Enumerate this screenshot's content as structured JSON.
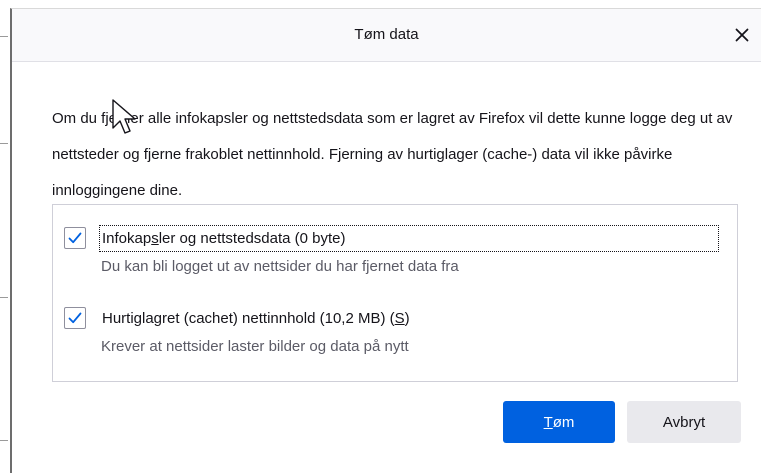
{
  "dialog": {
    "title": "Tøm data",
    "close_glyph": "✕",
    "description": "Om du fjerner alle infokapsler og nettstedsdata som er lagret av Firefox vil dette kunne logge deg ut av nettsteder og fjerne frakoblet nettinnhold. Fjerning av hurtiglager (cache-) data vil ikke påvirke innloggingene dine.",
    "options": [
      {
        "checked": true,
        "label_pre": "Infokap",
        "label_key": "s",
        "label_post": "ler og nettstedsdata (0 byte)",
        "sub": "Du kan bli logget ut av nettsider du har fjernet data fra"
      },
      {
        "checked": true,
        "label_pre": "Hurtiglagret (cachet) nettinnhold (10,2 MB) (",
        "label_key": "S",
        "label_post": ")",
        "sub": "Krever at nettsider laster bilder og data på nytt"
      }
    ],
    "buttons": {
      "clear_key": "T",
      "clear_rest": "øm",
      "cancel": "Avbryt"
    }
  },
  "icons": {
    "checkbox": "checkmark-icon",
    "close": "close-icon",
    "cursor": "mouse-pointer-icon"
  },
  "colors": {
    "accent": "#0061e0",
    "checkmark": "#0061e0",
    "secondary_button": "#e9e9ed",
    "titlebar": "#f9f9fb"
  }
}
